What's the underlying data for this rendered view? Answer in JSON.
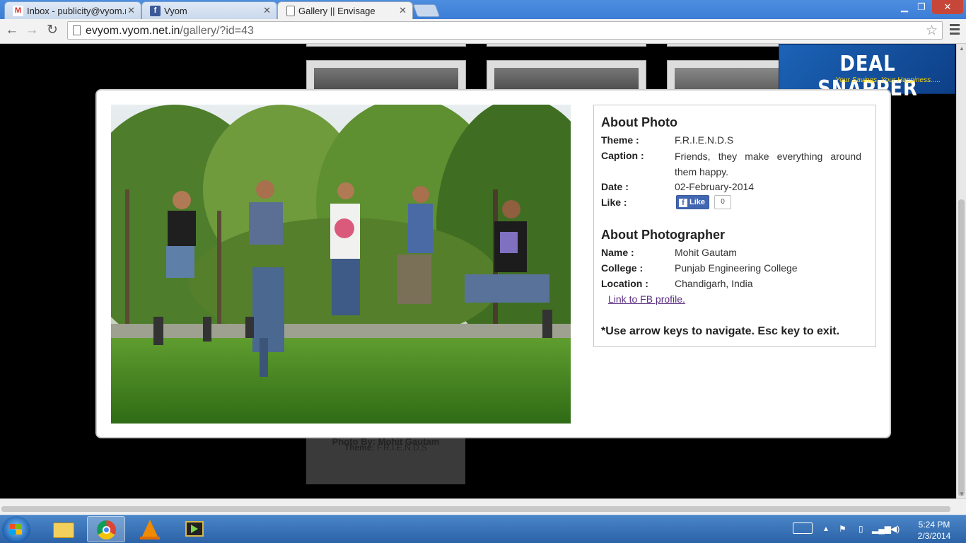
{
  "browser": {
    "tabs": [
      {
        "label": "Inbox - publicity@vyom.n",
        "icon": "gmail-icon"
      },
      {
        "label": "Vyom",
        "icon": "facebook-icon"
      },
      {
        "label": "Gallery || Envisage",
        "icon": "page-icon",
        "active": true
      }
    ],
    "url_host": "evyom.vyom.net.in",
    "url_path": "/gallery/?id=43"
  },
  "background_card": {
    "photo_by": "Photo By: Mohit Gautam",
    "theme_label": "Theme:",
    "theme_value": " F.R.I.E.N.D.S"
  },
  "ad": {
    "title": "DEAL SNAPPER",
    "tagline": "Your Savings, Your Happiness....."
  },
  "modal": {
    "about_photo_heading": "About Photo",
    "theme_label": "Theme :",
    "theme_value": "F.R.I.E.N.D.S",
    "caption_label": "Caption :",
    "caption_value": "Friends, they make everything around them happy.",
    "date_label": "Date :",
    "date_value": "02-February-2014",
    "like_label": "Like :",
    "like_button": "Like",
    "like_count": "0",
    "about_photographer_heading": "About Photographer",
    "name_label": "Name :",
    "name_value": "Mohit Gautam",
    "college_label": "College :",
    "college_value": "Punjab Engineering College",
    "location_label": "Location :",
    "location_value": "Chandigarh, India",
    "fb_link": "Link to FB profile.",
    "nav_hint": "*Use arrow keys to navigate. Esc key to exit."
  },
  "taskbar": {
    "apps": [
      "windows-explorer-icon",
      "chrome-icon",
      "vlc-icon",
      "movie-maker-icon"
    ],
    "time": "5:24 PM",
    "date": "2/3/2014"
  }
}
